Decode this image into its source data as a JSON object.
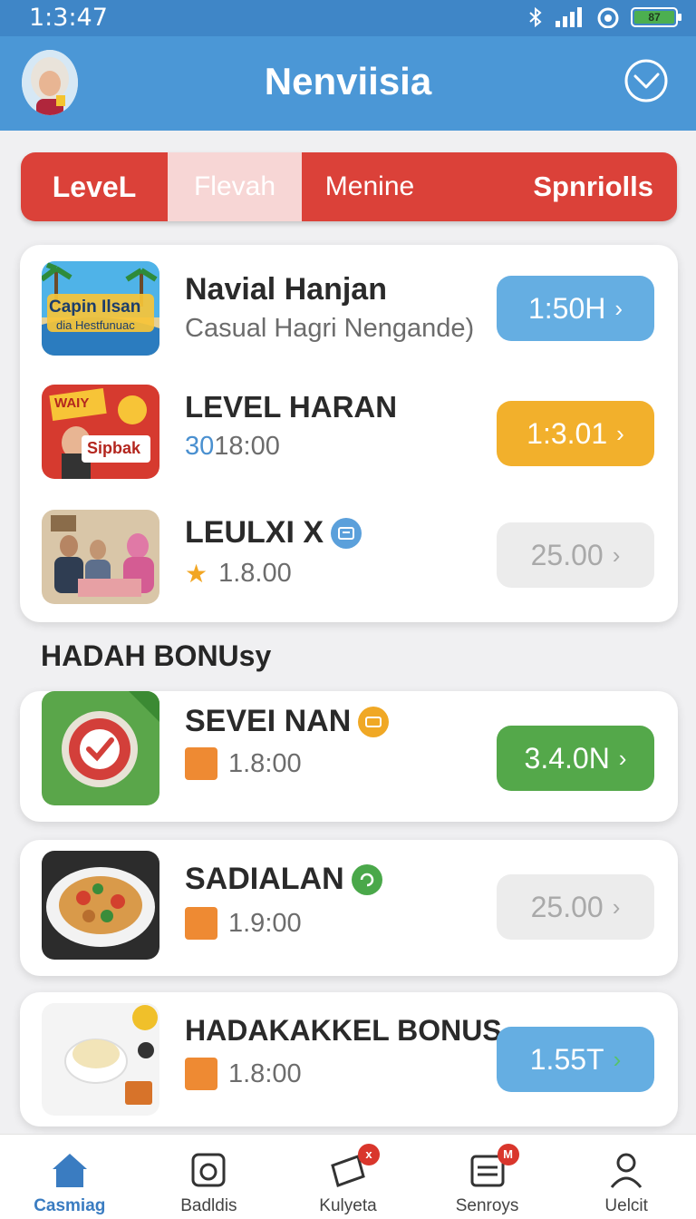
{
  "status_bar": {
    "time": "1:3:47",
    "battery_text": "87"
  },
  "header": {
    "title": "Nenviisia"
  },
  "tabs": [
    {
      "label": "LeveL"
    },
    {
      "label": "Flevah"
    },
    {
      "label": "Menine"
    },
    {
      "label": "Spnriolls"
    }
  ],
  "top_list": [
    {
      "title": "Navial Hanjan",
      "subtitle": "Casual Hagri Nengande)",
      "button": "1:50H",
      "thumb_text_1": "Capin Ilsan",
      "thumb_text_2": "dia Hestfunuac"
    },
    {
      "title": "LEVEL HARAN",
      "subtitle_highlight": "30",
      "subtitle": "18:00",
      "button": "1:3.01",
      "thumb_text_1": "WAIY",
      "thumb_text_2": "Sipbak"
    },
    {
      "title": "LEULXI X",
      "subtitle": "1.8.00",
      "button": "25.00"
    }
  ],
  "section": {
    "title": "HADAH BONUsy"
  },
  "bonus_list": [
    {
      "title": "SEVEI NAN",
      "subtitle": "1.8:00",
      "button": "3.4.0N"
    },
    {
      "title": "SADIALAN",
      "subtitle": "1.9:00",
      "button": "25.00"
    },
    {
      "title": "HADAKAKKEL BONUS",
      "subtitle": "1.8:00",
      "button": "1.55T"
    }
  ],
  "bottom_nav": [
    {
      "label": "Casmiag",
      "active": true
    },
    {
      "label": "Badldis"
    },
    {
      "label": "Kulyeta",
      "badge": "x"
    },
    {
      "label": "Senroys",
      "badge": "M"
    },
    {
      "label": "Uelcit"
    }
  ],
  "colors": {
    "header": "#4b97d6",
    "tab_bar": "#db4139",
    "pill_blue": "#65aee2",
    "pill_orange": "#f2b02c",
    "pill_green": "#54a84a",
    "nav_active": "#3a7cc1"
  },
  "icons": {
    "header_action": "check-circle-icon",
    "nav": [
      "home-icon",
      "bucket-icon",
      "ticket-icon",
      "calendar-icon",
      "user-icon"
    ]
  }
}
